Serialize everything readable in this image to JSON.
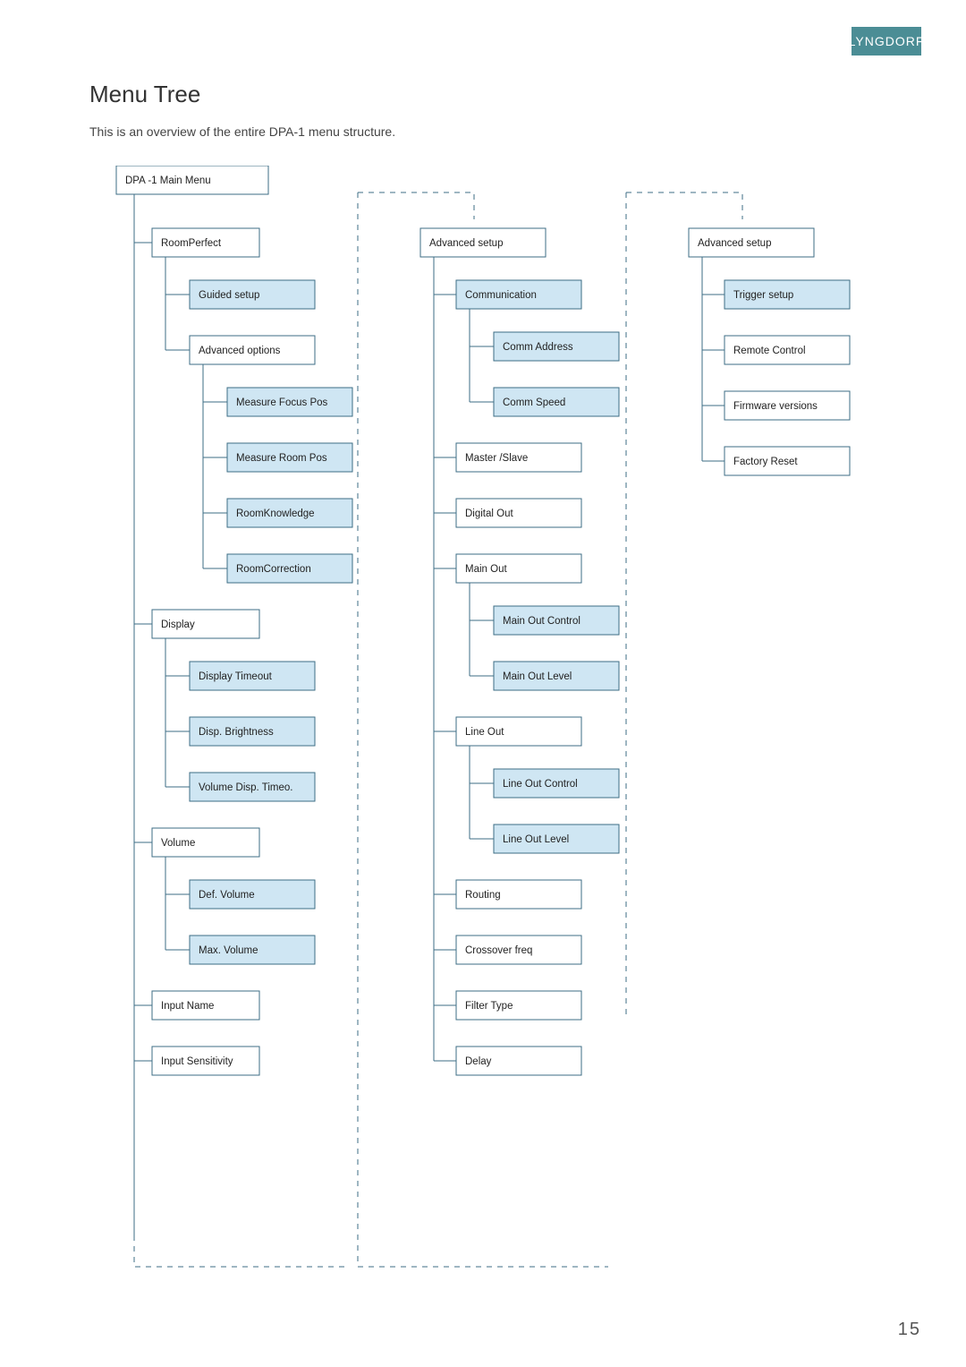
{
  "brand": "LYNGDORF",
  "heading": "Menu Tree",
  "subtitle": "This is an overview of the entire DPA-1 menu structure.",
  "page_number": "15",
  "tree": {
    "root": "DPA -1  Main Menu",
    "col1": [
      {
        "label": "RoomPerfect",
        "type": "box",
        "children": [
          {
            "label": "Guided setup",
            "type": "blue"
          },
          {
            "label": "Advanced options",
            "type": "box",
            "children": [
              {
                "label": "Measure Focus Pos",
                "type": "blue"
              },
              {
                "label": "Measure Room Pos",
                "type": "blue"
              },
              {
                "label": "RoomKnowledge",
                "type": "blue"
              },
              {
                "label": "RoomCorrection",
                "type": "blue"
              }
            ]
          }
        ]
      },
      {
        "label": "Display",
        "type": "box",
        "children": [
          {
            "label": "Display Timeout",
            "type": "blue"
          },
          {
            "label": "Disp.  Brightness",
            "type": "blue"
          },
          {
            "label": "Volume Disp.  Timeo.",
            "type": "blue"
          }
        ]
      },
      {
        "label": "Volume",
        "type": "box",
        "children": [
          {
            "label": "Def.  Volume",
            "type": "blue"
          },
          {
            "label": "Max.  Volume",
            "type": "blue"
          }
        ]
      },
      {
        "label": "Input Name",
        "type": "box"
      },
      {
        "label": "Input Sensitivity",
        "type": "box"
      }
    ],
    "col2": {
      "label": "Advanced setup",
      "type": "box",
      "children": [
        {
          "label": "Communication",
          "type": "blue",
          "children": [
            {
              "label": "Comm Address",
              "type": "blue"
            },
            {
              "label": "Comm Speed",
              "type": "blue"
            }
          ]
        },
        {
          "label": "Master /Slave",
          "type": "box"
        },
        {
          "label": "Digital Out",
          "type": "box"
        },
        {
          "label": "Main Out",
          "type": "box",
          "children": [
            {
              "label": "Main Out Control",
              "type": "blue"
            },
            {
              "label": "Main Out Level",
              "type": "blue"
            }
          ]
        },
        {
          "label": "Line Out",
          "type": "box",
          "children": [
            {
              "label": "Line Out Control",
              "type": "blue"
            },
            {
              "label": "Line Out Level",
              "type": "blue"
            }
          ]
        },
        {
          "label": "Routing",
          "type": "box"
        },
        {
          "label": "Crossover freq",
          "type": "box"
        },
        {
          "label": "Filter Type",
          "type": "box"
        },
        {
          "label": "Delay",
          "type": "box"
        }
      ]
    },
    "col3": {
      "label": "Advanced setup",
      "type": "box",
      "children": [
        {
          "label": "Trigger setup",
          "type": "blue"
        },
        {
          "label": "Remote Control",
          "type": "box"
        },
        {
          "label": "Firmware versions",
          "type": "box"
        },
        {
          "label": "Factory Reset",
          "type": "box"
        }
      ]
    }
  }
}
